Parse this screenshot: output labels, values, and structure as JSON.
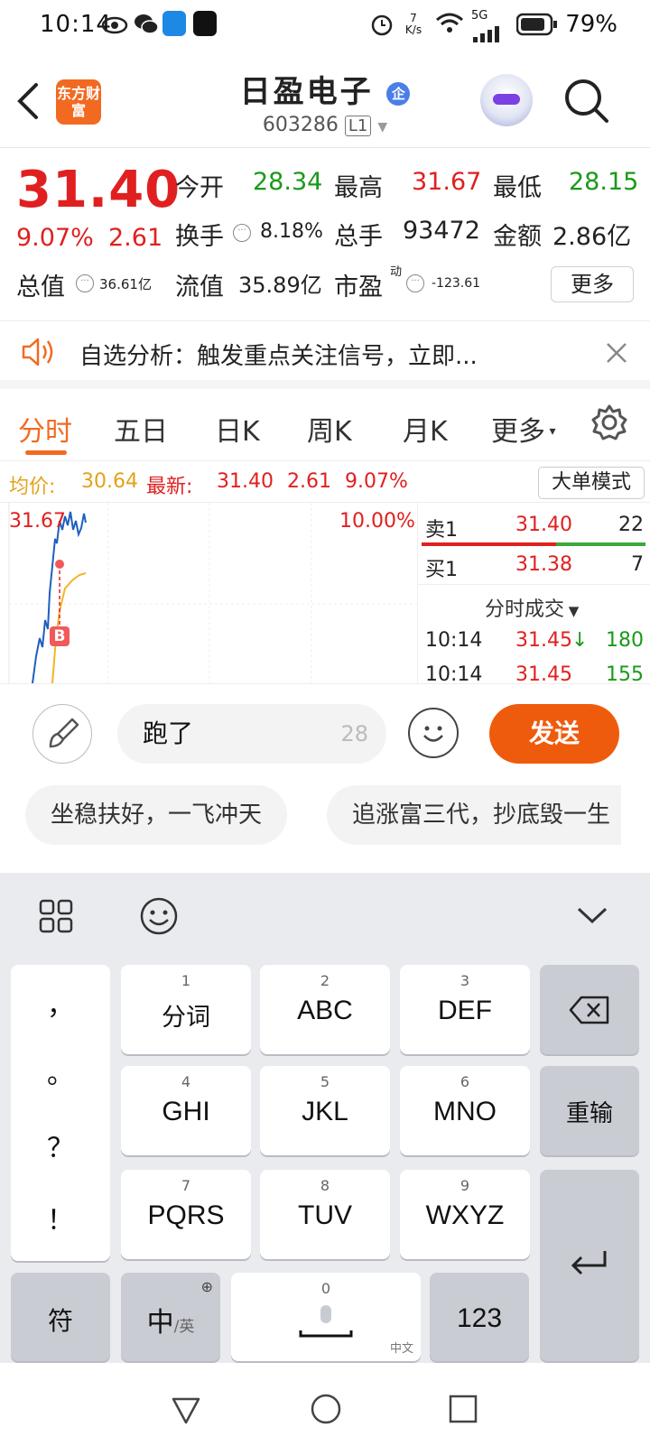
{
  "status_bar": {
    "time": "10:14",
    "net_speed": "7 K/s",
    "network": "5G",
    "battery": "79%"
  },
  "header": {
    "logo_text": "东方财富",
    "stock_name": "日盈电子",
    "badge": "企",
    "code": "603286",
    "level": "L1"
  },
  "quote": {
    "price": "31.40",
    "change_pct": "9.07%",
    "change": "2.61",
    "open_label": "今开",
    "open": "28.34",
    "high_label": "最高",
    "high": "31.67",
    "low_label": "最低",
    "low": "28.15",
    "turnover_label": "换手",
    "turnover": "8.18%",
    "volume_label": "总手",
    "volume": "93472",
    "amount_label": "金额",
    "amount": "2.86亿",
    "mktcap_label": "总值",
    "mktcap": "36.61亿",
    "float_label": "流值",
    "float_cap": "35.89亿",
    "pe_label": "市盈",
    "pe_sup": "动",
    "pe": "-123.61",
    "more_btn": "更多"
  },
  "banner": {
    "text": "自选分析：触发重点关注信号，立即..."
  },
  "tabs": [
    "分时",
    "五日",
    "日K",
    "周K",
    "月K",
    "更多"
  ],
  "avg_bar": {
    "avg_label": "均价:",
    "avg": "30.64",
    "latest_label": "最新:",
    "latest": "31.40",
    "change": "2.61",
    "pct": "9.07%",
    "mode_btn": "大单模式"
  },
  "chart": {
    "high_label": "31.67",
    "limit_pct": "10.00%",
    "buy_marker": "B"
  },
  "order_book": {
    "sell1": {
      "label": "卖1",
      "price": "31.40",
      "vol": "22"
    },
    "buy1": {
      "label": "买1",
      "price": "31.38",
      "vol": "7"
    },
    "trades_title": "分时成交",
    "trades": [
      {
        "time": "10:14",
        "price": "31.45",
        "vol": "180"
      },
      {
        "time": "10:14",
        "price": "31.45",
        "vol": "155"
      }
    ]
  },
  "comment": {
    "input": "跑了",
    "remaining": "28",
    "send": "发送"
  },
  "suggestions": [
    "坐稳扶好，一飞冲天",
    "追涨富三代，抄底毁一生"
  ],
  "keyboard": {
    "punct": [
      "，",
      "。",
      "？",
      "！"
    ],
    "keys": [
      {
        "num": "1",
        "label": "分词"
      },
      {
        "num": "2",
        "label": "ABC"
      },
      {
        "num": "3",
        "label": "DEF"
      },
      {
        "num": "4",
        "label": "GHI"
      },
      {
        "num": "5",
        "label": "JKL"
      },
      {
        "num": "6",
        "label": "MNO"
      },
      {
        "num": "7",
        "label": "PQRS"
      },
      {
        "num": "8",
        "label": "TUV"
      },
      {
        "num": "9",
        "label": "WXYZ"
      }
    ],
    "reinput": "重输",
    "symbol": "符",
    "lang_main": "中",
    "lang_sub": "/英",
    "space_num": "0",
    "space_sub": "中文",
    "num_key": "123"
  }
}
